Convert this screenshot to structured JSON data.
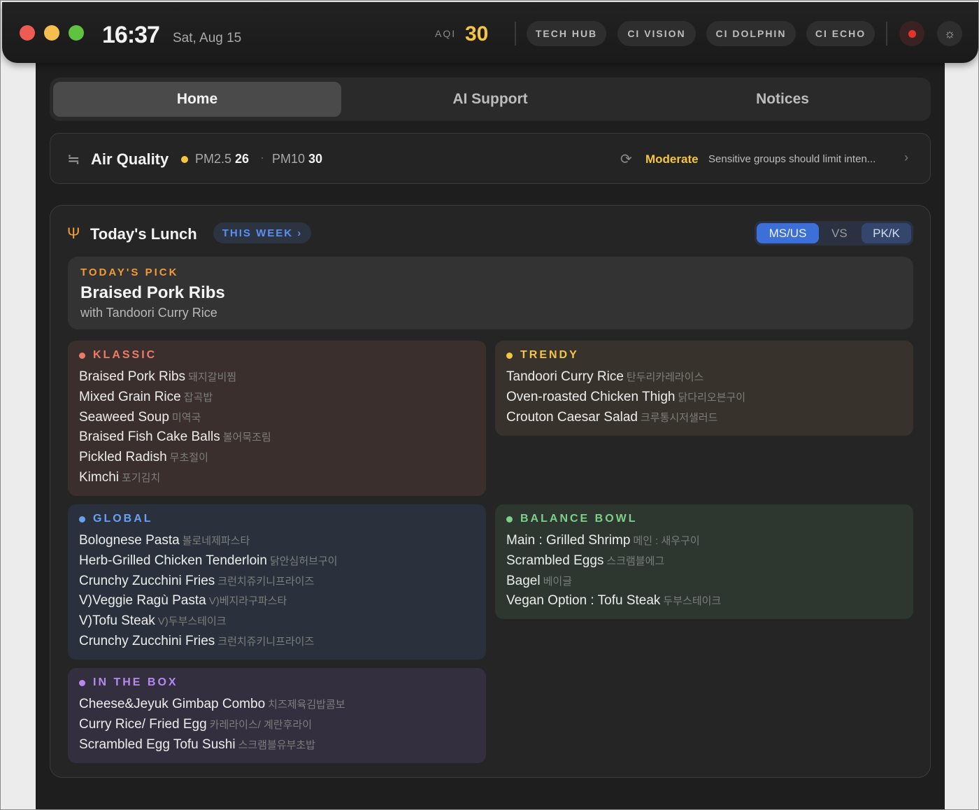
{
  "window": {
    "time": "16:37",
    "date": "Sat, Aug 15",
    "aqi_label": "AQI",
    "aqi_value": "30",
    "nav_pills": [
      "TECH HUB",
      "CI VISION",
      "CI DOLPHIN",
      "CI ECHO"
    ],
    "icons": {
      "record": "record-icon",
      "theme": "sun-icon"
    },
    "colors": {
      "aqi": "#f5c542",
      "record": "#e6342d"
    }
  },
  "tabs": [
    "Home",
    "AI Support",
    "Notices"
  ],
  "air_quality": {
    "title": "Air Quality",
    "pm25_label": "PM2.5",
    "pm25_value": "26",
    "separator": "·",
    "pm10_label": "PM10",
    "pm10_value": "30",
    "status": "Moderate",
    "advice": "Sensitive groups should limit inten...",
    "icons": {
      "wind": "wind-icon",
      "refresh": "refresh-icon",
      "more": "chevron-right-icon"
    }
  },
  "lunch": {
    "title": "Today's Lunch",
    "week_button": "THIS WEEK ›",
    "toggle": {
      "left": "MS/US",
      "vs": "VS",
      "right": "PK/K"
    },
    "todays_pick": {
      "label": "TODAY'S PICK",
      "title": "Braised Pork Ribs",
      "subtitle": "with Tandoori Curry Rice"
    },
    "categories": [
      {
        "name": "KLASSIC",
        "color": "#f07a6a",
        "items": [
          {
            "en": "Braised Pork Ribs",
            "ko": "돼지갈비찜"
          },
          {
            "en": "Mixed Grain Rice",
            "ko": "잡곡밥"
          },
          {
            "en": "Seaweed Soup",
            "ko": "미역국"
          },
          {
            "en": "Braised Fish Cake Balls",
            "ko": "볼어묵조림"
          },
          {
            "en": "Pickled Radish",
            "ko": "무초절이"
          },
          {
            "en": "Kimchi",
            "ko": "포기김치"
          }
        ]
      },
      {
        "name": "TRENDY",
        "color": "#f5c542",
        "items": [
          {
            "en": "Tandoori Curry Rice",
            "ko": "탄두리카레라이스"
          },
          {
            "en": "Oven-roasted Chicken Thigh",
            "ko": "닭다리오븐구이"
          },
          {
            "en": "Crouton Caesar Salad",
            "ko": "크루통시저샐러드"
          }
        ]
      },
      {
        "name": "GLOBAL",
        "color": "#6aa0f0",
        "items": [
          {
            "en": "Bolognese Pasta",
            "ko": "볼로네제파스타"
          },
          {
            "en": "Herb-Grilled Chicken Tenderloin",
            "ko": "닭안심허브구이"
          },
          {
            "en": "Crunchy Zucchini Fries",
            "ko": "크런치쥬키니프라이즈"
          },
          {
            "en": "V)Veggie Ragù Pasta",
            "ko": "V)베지라구파스타"
          },
          {
            "en": "V)Tofu Steak",
            "ko": "V)두부스테이크"
          },
          {
            "en": "Crunchy Zucchini Fries",
            "ko": "크런치쥬키니프라이즈"
          }
        ]
      },
      {
        "name": "BALANCE BOWL",
        "color": "#7ed089",
        "items": [
          {
            "en": "Main : Grilled Shrimp",
            "ko": "메인 : 새우구이"
          },
          {
            "en": "Scrambled Eggs",
            "ko": "스크램블에그"
          },
          {
            "en": "Bagel",
            "ko": "베이글"
          },
          {
            "en": "Vegan Option : Tofu Steak",
            "ko": "두부스테이크"
          }
        ]
      },
      {
        "name": "IN THE BOX",
        "color": "#b58af0",
        "items": [
          {
            "en": "Cheese&Jeyuk Gimbap Combo",
            "ko": "치즈제육김밥콤보"
          },
          {
            "en": "Curry Rice/ Fried Egg",
            "ko": "카레라이스/ 계란후라이"
          },
          {
            "en": "Scrambled Egg Tofu Sushi",
            "ko": "스크램블유부초밥"
          }
        ]
      }
    ]
  }
}
